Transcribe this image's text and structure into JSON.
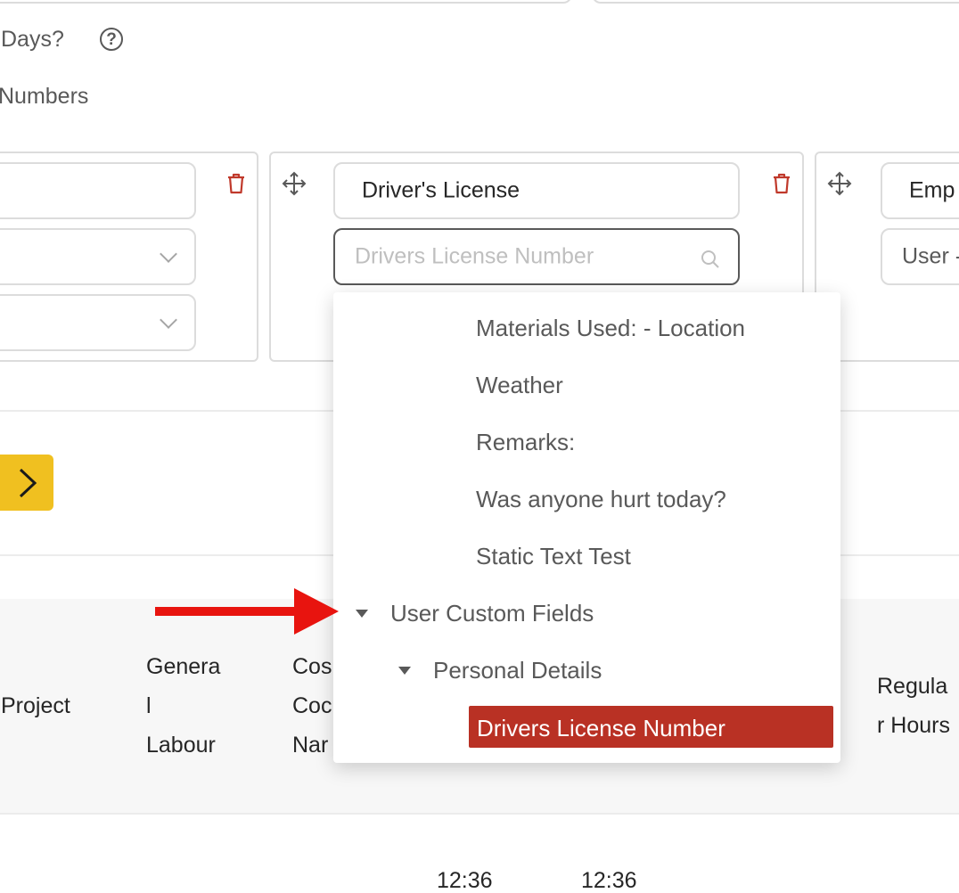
{
  "page": {
    "days_label": "Days?",
    "help_icon": "question-circle-icon",
    "numbers_label": "Numbers"
  },
  "cards": {
    "left": {
      "delete_icon": "trash-icon"
    },
    "middle": {
      "move_icon": "move-icon",
      "title_value": "Driver's License",
      "search_placeholder": "Drivers License Number",
      "search_icon": "search-icon",
      "delete_icon": "trash-icon"
    },
    "right": {
      "move_icon": "move-icon",
      "title_value": "Emp",
      "select_value": "User -"
    }
  },
  "next_button": {
    "icon": "chevron-right-icon"
  },
  "dropdown": {
    "items": [
      "Materials Used: - Location",
      "Weather",
      "Remarks:",
      "Was anyone hurt today?",
      "Static Text Test"
    ],
    "group": "User Custom Fields",
    "subgroup": "Personal Details",
    "selected": "Drivers License Number"
  },
  "annotation": {
    "arrow_color": "#e8140f"
  },
  "table": {
    "headers": {
      "project": "Project",
      "general_labour": [
        "Genera",
        "l",
        "Labour"
      ],
      "cost_code_name": [
        "Cos",
        "Coc",
        "Nar"
      ],
      "regular_hours": [
        "Regula",
        "r Hours"
      ]
    },
    "row_values": [
      "12:36",
      "12:36"
    ]
  },
  "colors": {
    "accent_yellow": "#f0c020",
    "selected_red": "#b93124",
    "delete_red": "#c0392b"
  }
}
